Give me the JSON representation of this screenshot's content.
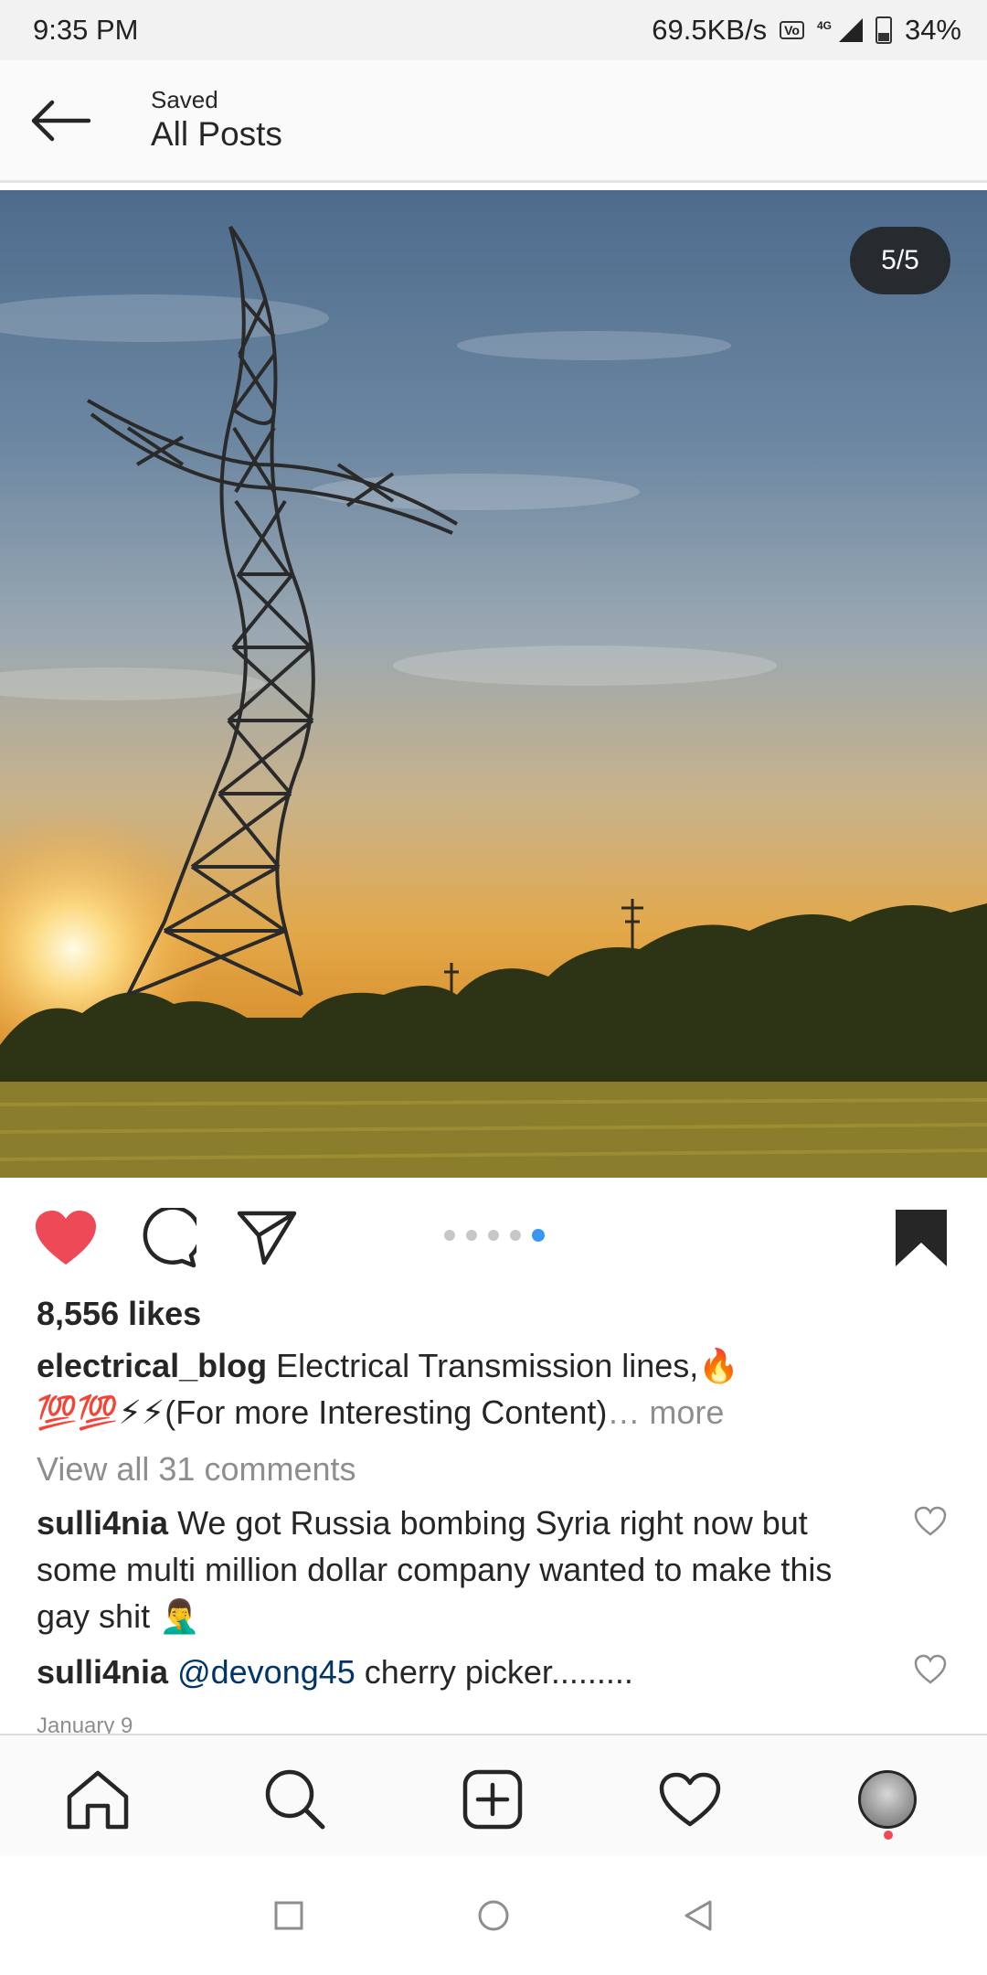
{
  "status_bar": {
    "time": "9:35 PM",
    "net_speed": "69.5KB/s",
    "volte": "Vo LTE",
    "network": "4G",
    "battery": "34%"
  },
  "header": {
    "subtitle": "Saved",
    "title": "All Posts"
  },
  "post": {
    "counter": "5/5",
    "carousel_total": 5,
    "carousel_current": 5,
    "liked": true,
    "saved": true,
    "likes": "8,556 likes",
    "author": "electrical_blog",
    "caption_text": "Electrical Transmission lines,🔥",
    "caption_line2": "💯💯⚡⚡(For more Interesting Content)",
    "more_label": "… more",
    "view_all": "View all 31 comments",
    "comments": [
      {
        "user": "sulli4nia",
        "text": "We got Russia bombing Syria right now but some multi million dollar company wanted to make this gay shit 🤦‍♂️"
      },
      {
        "user": "sulli4nia",
        "mention": "@devong45",
        "text": "cherry picker........."
      }
    ],
    "date": "January 9"
  },
  "colors": {
    "like_red": "#ed4956",
    "link_blue": "#003569",
    "dot_active": "#3897f0",
    "muted": "#8e8e8e"
  },
  "icons": {
    "back": "arrow-left-icon",
    "like": "heart-filled-icon",
    "comment": "comment-bubble-icon",
    "share": "paper-plane-icon",
    "save": "bookmark-filled-icon",
    "nav": [
      "home-icon",
      "search-icon",
      "add-post-icon",
      "activity-heart-icon",
      "profile-avatar"
    ],
    "system": [
      "recents-square-icon",
      "home-circle-icon",
      "back-triangle-icon"
    ]
  }
}
